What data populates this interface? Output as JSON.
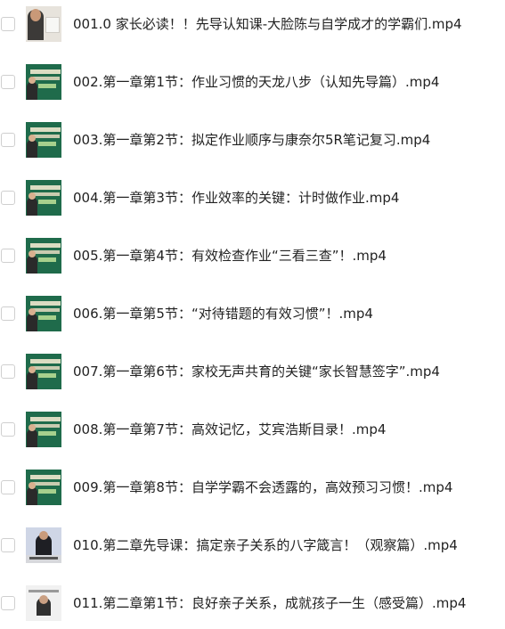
{
  "files": [
    {
      "name": "001.0 家长必读！！先导认知课-大脸陈与自学成才的学霸们.mp4",
      "thumbnail": "video-thumbnail-icon"
    },
    {
      "name": "002.第一章第1节：作业习惯的天龙八步（认知先导篇）.mp4",
      "thumbnail": "video-thumbnail-icon"
    },
    {
      "name": "003.第一章第2节：拟定作业顺序与康奈尔5R笔记复习.mp4",
      "thumbnail": "video-thumbnail-icon"
    },
    {
      "name": "004.第一章第3节：作业效率的关键：计时做作业.mp4",
      "thumbnail": "video-thumbnail-icon"
    },
    {
      "name": "005.第一章第4节：有效检查作业“三看三查”！.mp4",
      "thumbnail": "video-thumbnail-icon"
    },
    {
      "name": "006.第一章第5节：“对待错题的有效习惯”！.mp4",
      "thumbnail": "video-thumbnail-icon"
    },
    {
      "name": "007.第一章第6节：家校无声共育的关键“家长智慧签字”.mp4",
      "thumbnail": "video-thumbnail-icon"
    },
    {
      "name": "008.第一章第7节：高效记忆，艾宾浩斯目录！.mp4",
      "thumbnail": "video-thumbnail-icon"
    },
    {
      "name": "009.第一章第8节：自学学霸不会透露的，高效预习习惯！.mp4",
      "thumbnail": "video-thumbnail-icon"
    },
    {
      "name": "010.第二章先导课：搞定亲子关系的八字箴言！（观察篇）.mp4",
      "thumbnail": "video-thumbnail-icon"
    },
    {
      "name": "011.第二章第1节：良好亲子关系，成就孩子一生（感受篇）.mp4",
      "thumbnail": "video-thumbnail-icon"
    }
  ]
}
